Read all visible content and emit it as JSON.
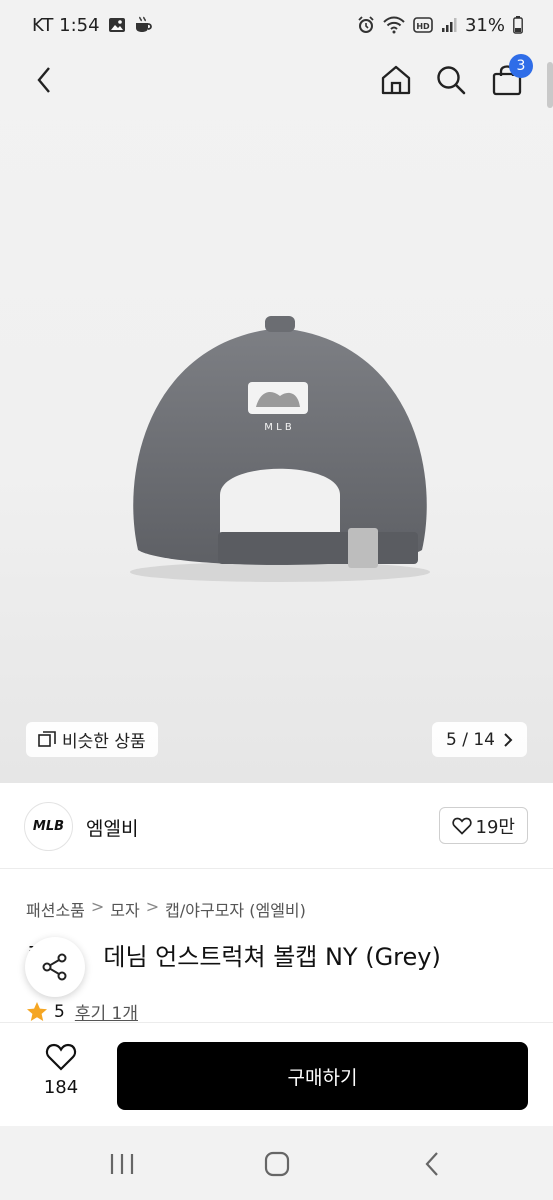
{
  "status_bar": {
    "carrier_time": "KT 1:54",
    "battery": "31%",
    "icons": [
      "gallery-icon",
      "coffee-icon",
      "alarm-icon",
      "wifi-icon",
      "hd-icon",
      "signal-icon",
      "battery-icon"
    ]
  },
  "nav": {
    "cart_count": "3",
    "icons": [
      "back-icon",
      "home-icon",
      "search-icon",
      "cart-icon"
    ]
  },
  "hero": {
    "image_subject": "grey denim baseball cap rear view",
    "cap_logo_text": "M L B",
    "similar_label": "비슷한 상품",
    "page_indicator": "5 / 14"
  },
  "seller": {
    "logo_text": "MLB",
    "name": "엠엘비",
    "likes": "19만"
  },
  "product": {
    "breadcrumb": [
      "패션소품",
      "모자",
      "캡/야구모자 (엠엘비)"
    ],
    "title_visible": "데님 언스트럭쳐 볼캡 NY (Grey)",
    "title_partial": "루",
    "rating": "5",
    "review_label": "후기 1개"
  },
  "buy_bar": {
    "wish_count": "184",
    "purchase_label": "구매하기"
  },
  "colors": {
    "badge": "#2f6de8",
    "purchase_button": "#000000",
    "star": "#f5a623"
  }
}
